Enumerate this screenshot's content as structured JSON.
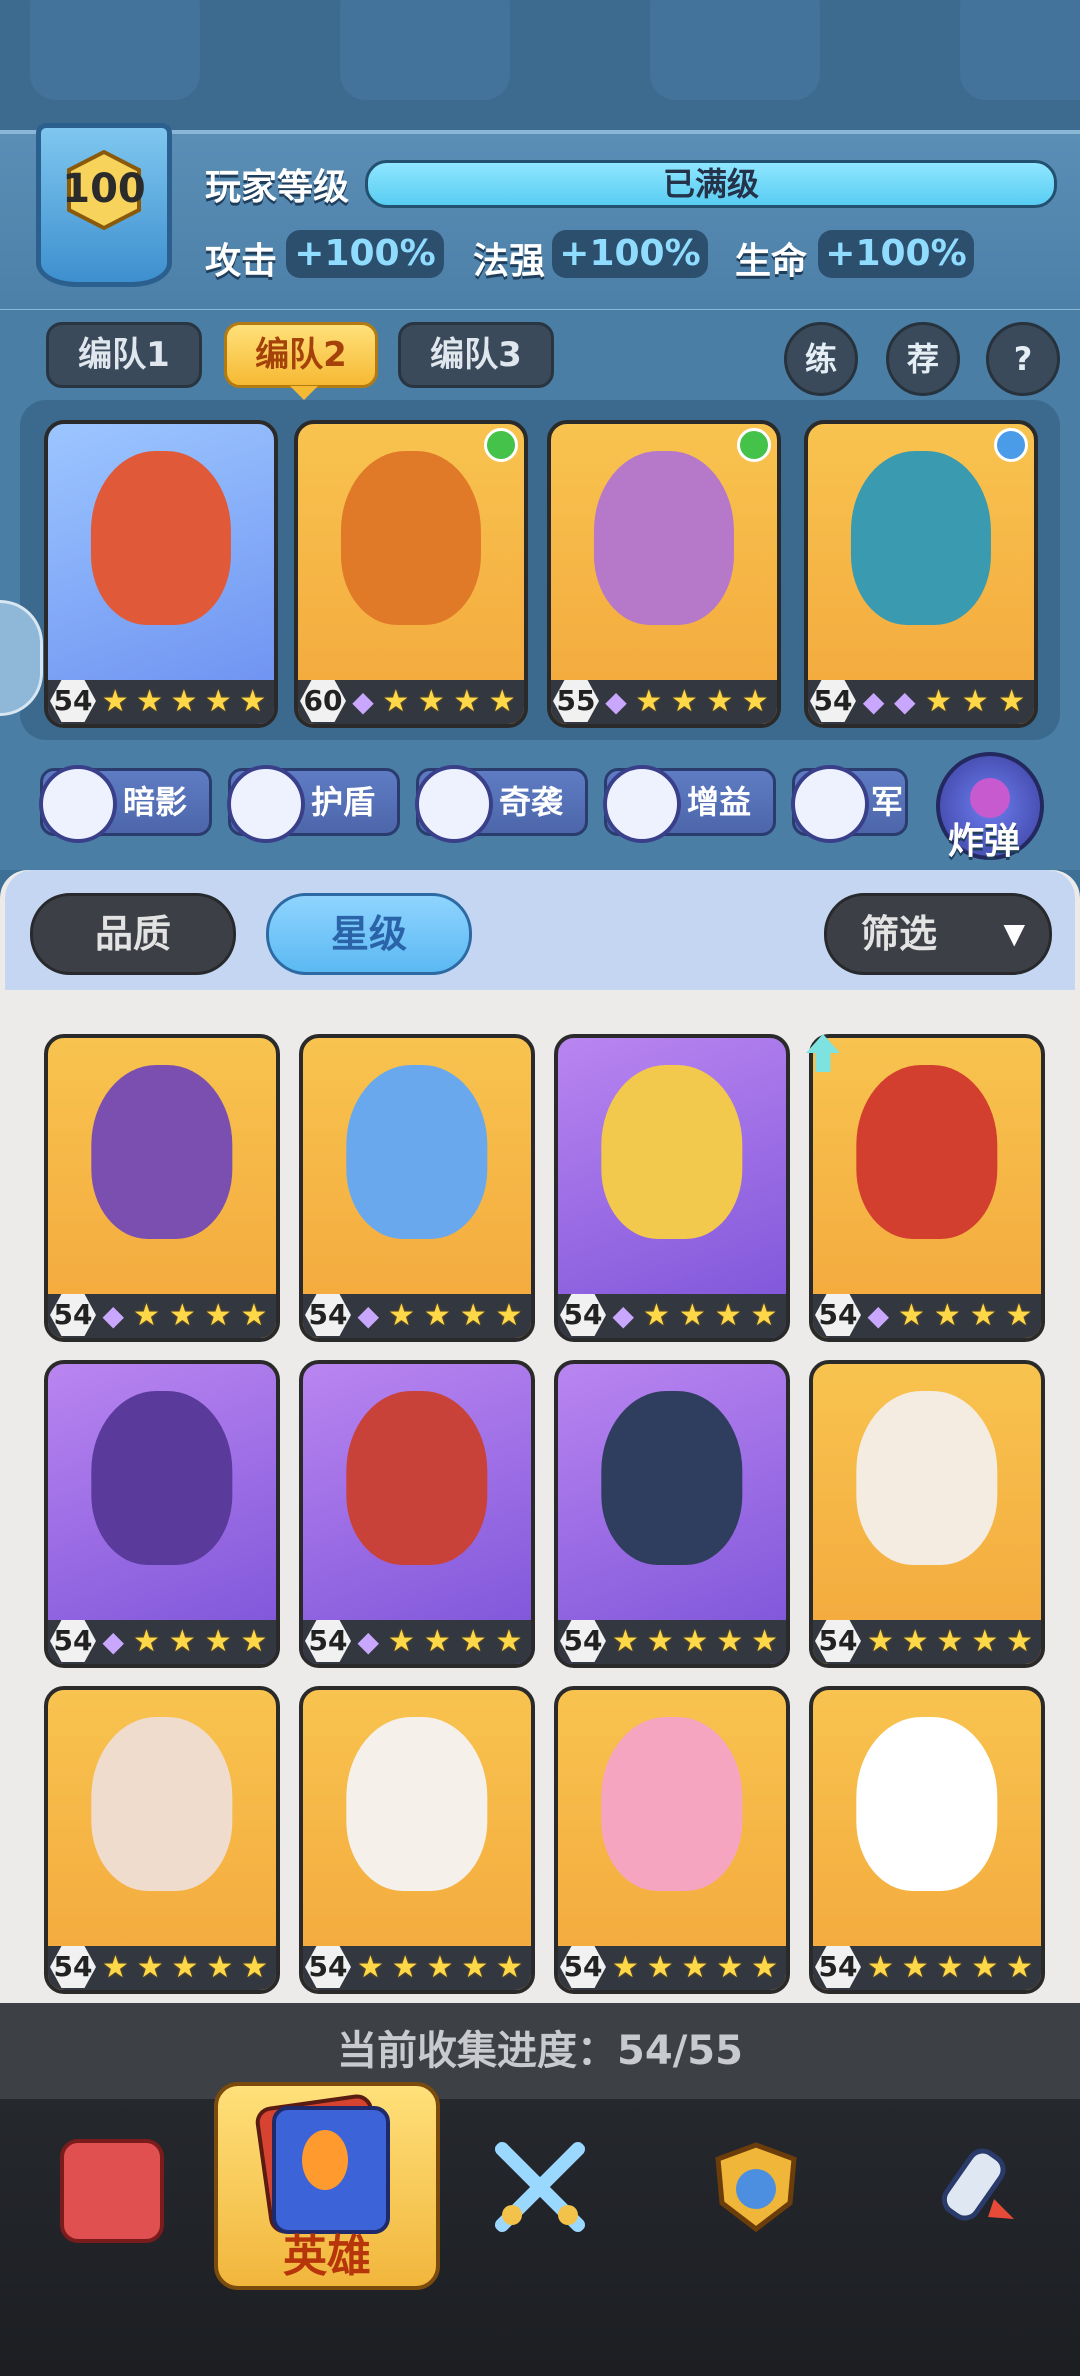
{
  "player": {
    "level": "100",
    "level_label": "玩家等级",
    "level_status": "已满级",
    "stats": [
      {
        "label": "攻击",
        "value": "+100%"
      },
      {
        "label": "法强",
        "value": "+100%"
      },
      {
        "label": "生命",
        "value": "+100%"
      }
    ]
  },
  "team_tabs": [
    {
      "label": "编队1",
      "active": false
    },
    {
      "label": "编队2",
      "active": true
    },
    {
      "label": "编队3",
      "active": false
    }
  ],
  "round_buttons": [
    "练",
    "荐",
    "?"
  ],
  "lineup": [
    {
      "level": "54",
      "gems": 0,
      "stars": 5,
      "bg": "bluebg",
      "face": "#e05a3a",
      "dot": null
    },
    {
      "level": "60",
      "gems": 1,
      "stars": 4,
      "bg": "",
      "face": "#e07a28",
      "dot": "#44c24a"
    },
    {
      "level": "55",
      "gems": 1,
      "stars": 4,
      "bg": "",
      "face": "#b678c8",
      "dot": "#44c24a"
    },
    {
      "level": "54",
      "gems": 2,
      "stars": 3,
      "bg": "",
      "face": "#3a9ab0",
      "dot": "#4a9be8"
    }
  ],
  "type_chips": [
    {
      "label": "暗影"
    },
    {
      "label": "护盾"
    },
    {
      "label": "奇袭"
    },
    {
      "label": "增益"
    },
    {
      "label": "军"
    }
  ],
  "bomb_label": "炸弹",
  "sort": {
    "quality": "品质",
    "star": "星级",
    "filter": "筛选"
  },
  "heroes": [
    {
      "level": "54",
      "gems": 1,
      "stars": 4,
      "bg": "",
      "face": "#7a4fb0"
    },
    {
      "level": "54",
      "gems": 1,
      "stars": 4,
      "bg": "",
      "face": "#6aa8ee"
    },
    {
      "level": "54",
      "gems": 1,
      "stars": 4,
      "bg": "purple",
      "face": "#f2c94c"
    },
    {
      "level": "54",
      "gems": 1,
      "stars": 4,
      "bg": "",
      "face": "#d23f2e"
    },
    {
      "level": "54",
      "gems": 1,
      "stars": 4,
      "bg": "purple",
      "face": "#5a3a9a"
    },
    {
      "level": "54",
      "gems": 1,
      "stars": 4,
      "bg": "purple",
      "face": "#c8423a"
    },
    {
      "level": "54",
      "gems": 0,
      "stars": 5,
      "bg": "purple",
      "face": "#2f3d5e"
    },
    {
      "level": "54",
      "gems": 0,
      "stars": 5,
      "bg": "",
      "face": "#f4ece0"
    },
    {
      "level": "54",
      "gems": 0,
      "stars": 5,
      "bg": "",
      "face": "#f0dccd"
    },
    {
      "level": "54",
      "gems": 0,
      "stars": 5,
      "bg": "",
      "face": "#f5f1ea"
    },
    {
      "level": "54",
      "gems": 0,
      "stars": 5,
      "bg": "",
      "face": "#f6a5c0"
    },
    {
      "level": "54",
      "gems": 0,
      "stars": 5,
      "bg": "",
      "face": "#ffffff"
    }
  ],
  "collection_progress": "当前收集进度：54/55",
  "nav": {
    "hero_label": "英雄",
    "items": [
      {
        "name": "shop",
        "color": "#e05050"
      },
      {
        "name": "hero",
        "color": "#3d63d8"
      },
      {
        "name": "battle",
        "color": "#6ec2f3"
      },
      {
        "name": "guild",
        "color": "#f0b63a"
      },
      {
        "name": "rocket",
        "color": "#c9d8ea"
      }
    ]
  }
}
